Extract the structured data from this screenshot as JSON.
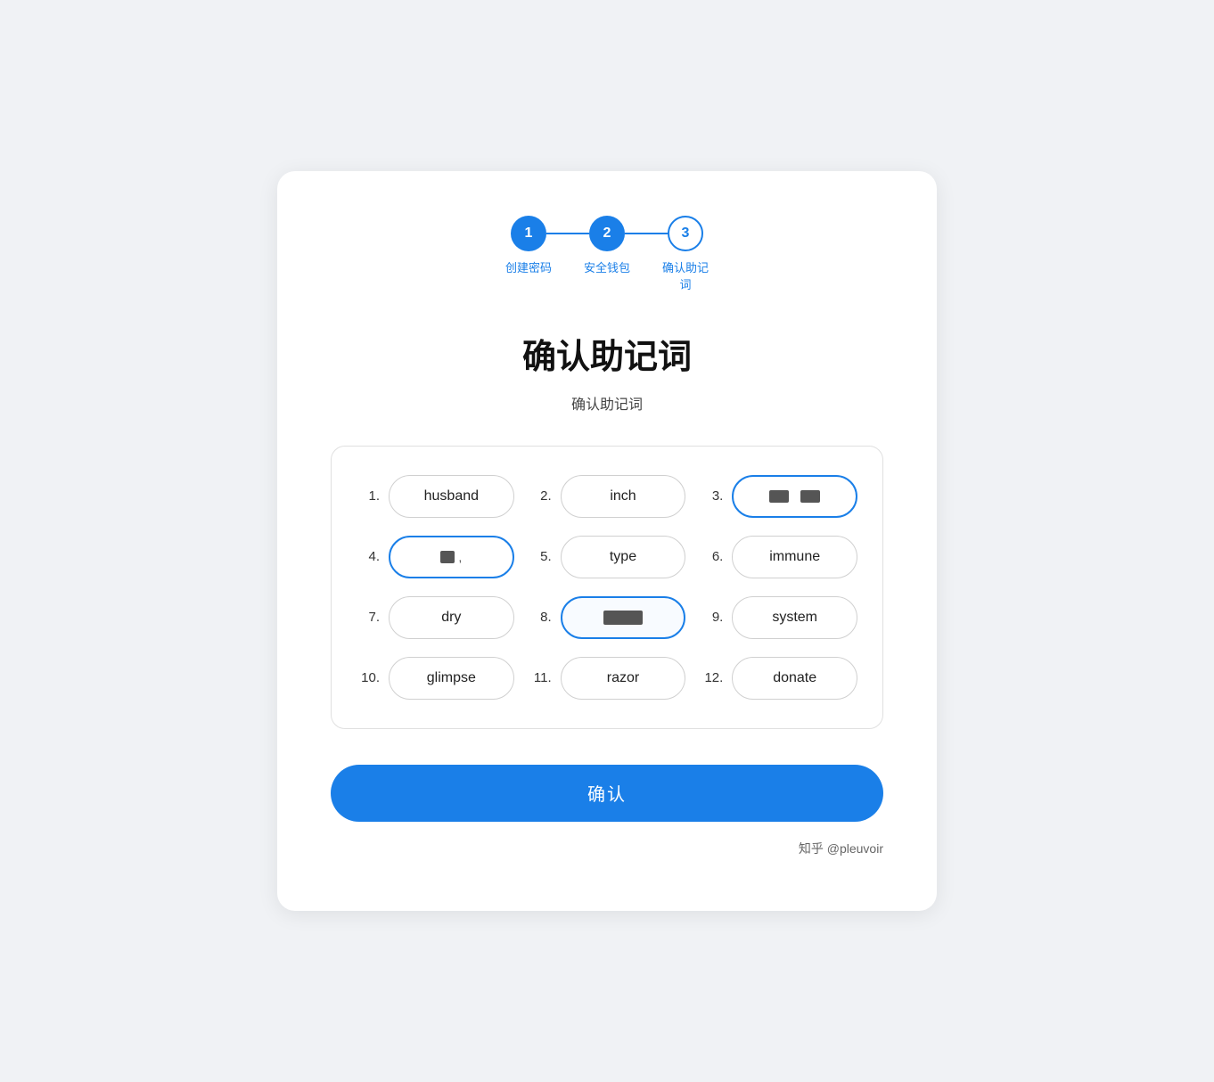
{
  "stepper": {
    "steps": [
      {
        "number": "1",
        "type": "filled"
      },
      {
        "number": "2",
        "type": "filled"
      },
      {
        "number": "3",
        "type": "outline"
      }
    ],
    "labels": [
      {
        "text": "创建密码"
      },
      {
        "text": "安全钱包"
      },
      {
        "text": "确认助记\n词"
      }
    ]
  },
  "page": {
    "title": "确认助记词",
    "subtitle": "确认助记词"
  },
  "words": [
    {
      "number": "1.",
      "text": "husband",
      "style": "normal"
    },
    {
      "number": "2.",
      "text": "inch",
      "style": "normal"
    },
    {
      "number": "3.",
      "text": "redacted3",
      "style": "active-blue"
    },
    {
      "number": "4.",
      "text": "redacted4",
      "style": "active-blue"
    },
    {
      "number": "5.",
      "text": "type",
      "style": "normal"
    },
    {
      "number": "6.",
      "text": "immune",
      "style": "normal"
    },
    {
      "number": "7.",
      "text": "dry",
      "style": "normal"
    },
    {
      "number": "8.",
      "text": "redacted8",
      "style": "typing"
    },
    {
      "number": "9.",
      "text": "system",
      "style": "normal"
    },
    {
      "number": "10.",
      "text": "glimpse",
      "style": "normal"
    },
    {
      "number": "11.",
      "text": "razor",
      "style": "normal"
    },
    {
      "number": "12.",
      "text": "donate",
      "style": "normal"
    }
  ],
  "confirm_button": {
    "label": "确认"
  },
  "watermark": {
    "text": "知乎 @pleuvoir"
  }
}
